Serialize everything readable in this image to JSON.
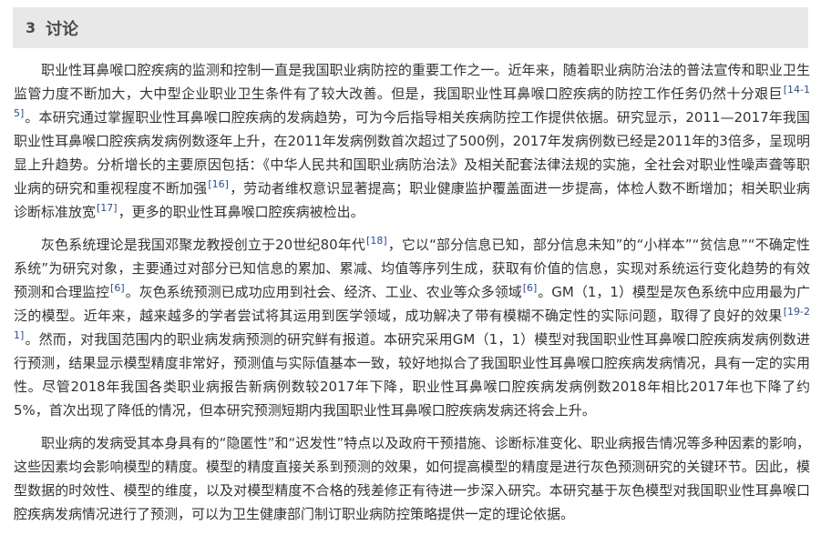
{
  "section": {
    "number": "3",
    "title": "讨论"
  },
  "paragraphs": [
    {
      "segments": [
        {
          "text": "职业性耳鼻喉口腔疾病的监测和控制一直是我国职业病防控的重要工作之一。近年来，随着职业病防治法的普法宣传和职业卫生监管力度不断加大，大中型企业职业卫生条件有了较大改善。但是，我国职业性耳鼻喉口腔疾病的防控工作任务仍然十分艰巨"
        },
        {
          "cite": "[14-15]"
        },
        {
          "text": "。本研究通过掌握职业性耳鼻喉口腔疾病的发病趋势，可为今后指导相关疾病防控工作提供依据。研究显示，2011—2017年我国职业性耳鼻喉口腔疾病发病例数逐年上升，在2011年发病例数首次超过了500例，2017年发病例数已经是2011年的3倍多，呈现明显上升趋势。分析增长的主要原因包括：《中华人民共和国职业病防治法》及相关配套法律法规的实施，全社会对职业性噪声聋等职业病的研究和重视程度不断加强"
        },
        {
          "cite": "[16]"
        },
        {
          "text": "，劳动者维权意识显著提高；职业健康监护覆盖面进一步提高，体检人数不断增加；相关职业病诊断标准放宽"
        },
        {
          "cite": "[17]"
        },
        {
          "text": "，更多的职业性耳鼻喉口腔疾病被检出。"
        }
      ]
    },
    {
      "segments": [
        {
          "text": "灰色系统理论是我国邓聚龙教授创立于20世纪80年代"
        },
        {
          "cite": "[18]"
        },
        {
          "text": "，它以“部分信息已知，部分信息未知”的“小样本”“贫信息”“不确定性系统”为研究对象，主要通过对部分已知信息的累加、累减、均值等序列生成，获取有价值的信息，实现对系统运行变化趋势的有效预测和合理监控"
        },
        {
          "cite": "[6]"
        },
        {
          "text": "。灰色系统预测已成功应用到社会、经济、工业、农业等众多领域"
        },
        {
          "cite": "[6]"
        },
        {
          "text": "。GM（1，1）模型是灰色系统中应用最为广泛的模型。近年来，越来越多的学者尝试将其运用到医学领域，成功解决了带有模糊不确定性的实际问题，取得了良好的效果"
        },
        {
          "cite": "[19-21]"
        },
        {
          "text": "。然而，对我国范围内的职业病发病预测的研究鲜有报道。本研究采用GM（1，1）模型对我国职业性耳鼻喉口腔疾病发病例数进行预测，结果显示模型精度非常好，预测值与实际值基本一致，较好地拟合了我国职业性耳鼻喉口腔疾病发病情况，具有一定的实用性。尽管2018年我国各类职业病报告新病例数较2017年下降，职业性耳鼻喉口腔疾病发病例数2018年相比2017年也下降了约5%，首次出现了降低的情况，但本研究预测短期内我国职业性耳鼻喉口腔疾病发病还将会上升。"
        }
      ]
    },
    {
      "segments": [
        {
          "text": "职业病的发病受其本身具有的“隐匿性”和“迟发性”特点以及政府干预措施、诊断标准变化、职业病报告情况等多种因素的影响，这些因素均会影响模型的精度。模型的精度直接关系到预测的效果，如何提高模型的精度是进行灰色预测研究的关键环节。因此，模型数据的时效性、模型的维度，以及对模型精度不合格的残差修正有待进一步深入研究。本研究基于灰色模型对我国职业性耳鼻喉口腔疾病发病情况进行了预测，可以为卫生健康部门制订职业病防控策略提供一定的理论依据。"
        }
      ]
    }
  ]
}
